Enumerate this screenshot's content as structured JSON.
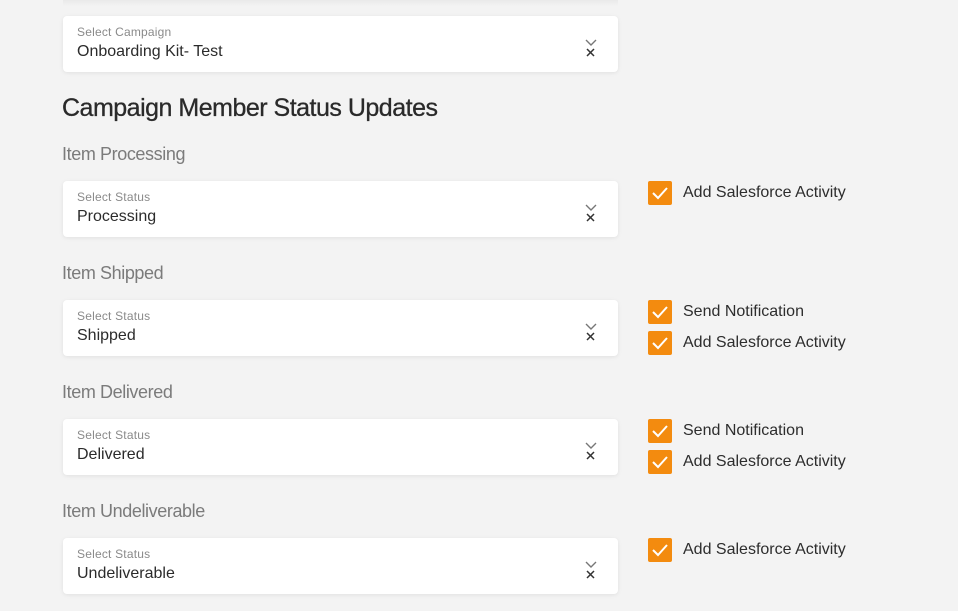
{
  "campaign": {
    "label": "Select Campaign",
    "value": "Onboarding Kit- Test"
  },
  "section_title": "Campaign Member Status Updates",
  "groups": [
    {
      "title": "Item Processing",
      "select_label": "Select Status",
      "value": "Processing",
      "checkboxes": [
        {
          "label": "Add Salesforce Activity",
          "checked": true
        }
      ]
    },
    {
      "title": "Item Shipped",
      "select_label": "Select Status",
      "value": "Shipped",
      "checkboxes": [
        {
          "label": "Send Notification",
          "checked": true
        },
        {
          "label": "Add Salesforce Activity",
          "checked": true
        }
      ]
    },
    {
      "title": "Item Delivered",
      "select_label": "Select Status",
      "value": "Delivered",
      "checkboxes": [
        {
          "label": "Send Notification",
          "checked": true
        },
        {
          "label": "Add Salesforce Activity",
          "checked": true
        }
      ]
    },
    {
      "title": "Item Undeliverable",
      "select_label": "Select Status",
      "value": "Undeliverable",
      "checkboxes": [
        {
          "label": "Add Salesforce Activity",
          "checked": true
        }
      ]
    }
  ],
  "colors": {
    "accent": "#f38b0f",
    "background": "#f3f3f3",
    "card": "#ffffff"
  },
  "icons": {
    "dropdown": "chevron-down-icon",
    "clear": "clear-x-icon",
    "check": "checkmark-icon"
  }
}
